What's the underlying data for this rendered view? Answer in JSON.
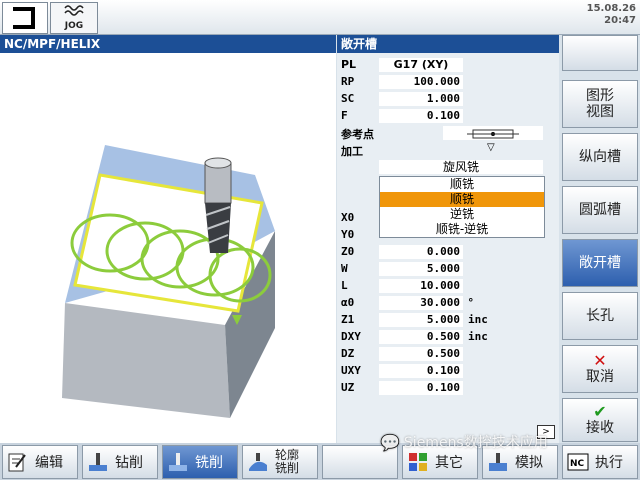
{
  "top": {
    "mode": "JOG",
    "date": "15.08.26",
    "time": "20:47"
  },
  "header": {
    "left": "NC/MPF/HELIX",
    "right": "敞开槽"
  },
  "form": {
    "PL": {
      "k": "PL",
      "v": "G17 (XY)"
    },
    "RP": {
      "k": "RP",
      "v": "100.000"
    },
    "SC": {
      "k": "SC",
      "v": "1.000"
    },
    "F": {
      "k": "F",
      "v": "0.100"
    },
    "ref_label": "参考点",
    "machining_label": "加工",
    "machining_value": "旋风铣",
    "dropdown": [
      "顺铣",
      "顺铣",
      "逆铣",
      "顺铣-逆铣"
    ],
    "X0": {
      "k": "X0"
    },
    "Y0": {
      "k": "Y0"
    },
    "Z0": {
      "k": "Z0",
      "v": "0.000"
    },
    "W": {
      "k": "W",
      "v": "5.000"
    },
    "L": {
      "k": "L",
      "v": "10.000"
    },
    "a0": {
      "k": "α0",
      "v": "30.000",
      "u": "°"
    },
    "Z1": {
      "k": "Z1",
      "v": "5.000",
      "u": "inc"
    },
    "DXY": {
      "k": "DXY",
      "v": "0.500",
      "u": "inc"
    },
    "DZ": {
      "k": "DZ",
      "v": "0.500"
    },
    "UXY": {
      "k": "UXY",
      "v": "0.100"
    },
    "UZ": {
      "k": "UZ",
      "v": "0.100"
    }
  },
  "softkeys": {
    "graphic": "图形\n视图",
    "longitudinal": "纵向槽",
    "circular": "圆弧槽",
    "open": "敞开槽",
    "long_hole": "长孔",
    "cancel": "取消",
    "accept": "接收"
  },
  "bottom": {
    "edit": "编辑",
    "drill": "钻削",
    "mill": "铣削",
    "contour": "轮廓\n铣削",
    "other": "其它",
    "simulate": "模拟",
    "execute": "执行"
  },
  "watermark": "Siemens数控技术应用",
  "colors": {
    "header": "#1c4f96",
    "selected": "#f0960a",
    "active_softkey": "#2d5fae",
    "helix": "#8ccc3c"
  }
}
